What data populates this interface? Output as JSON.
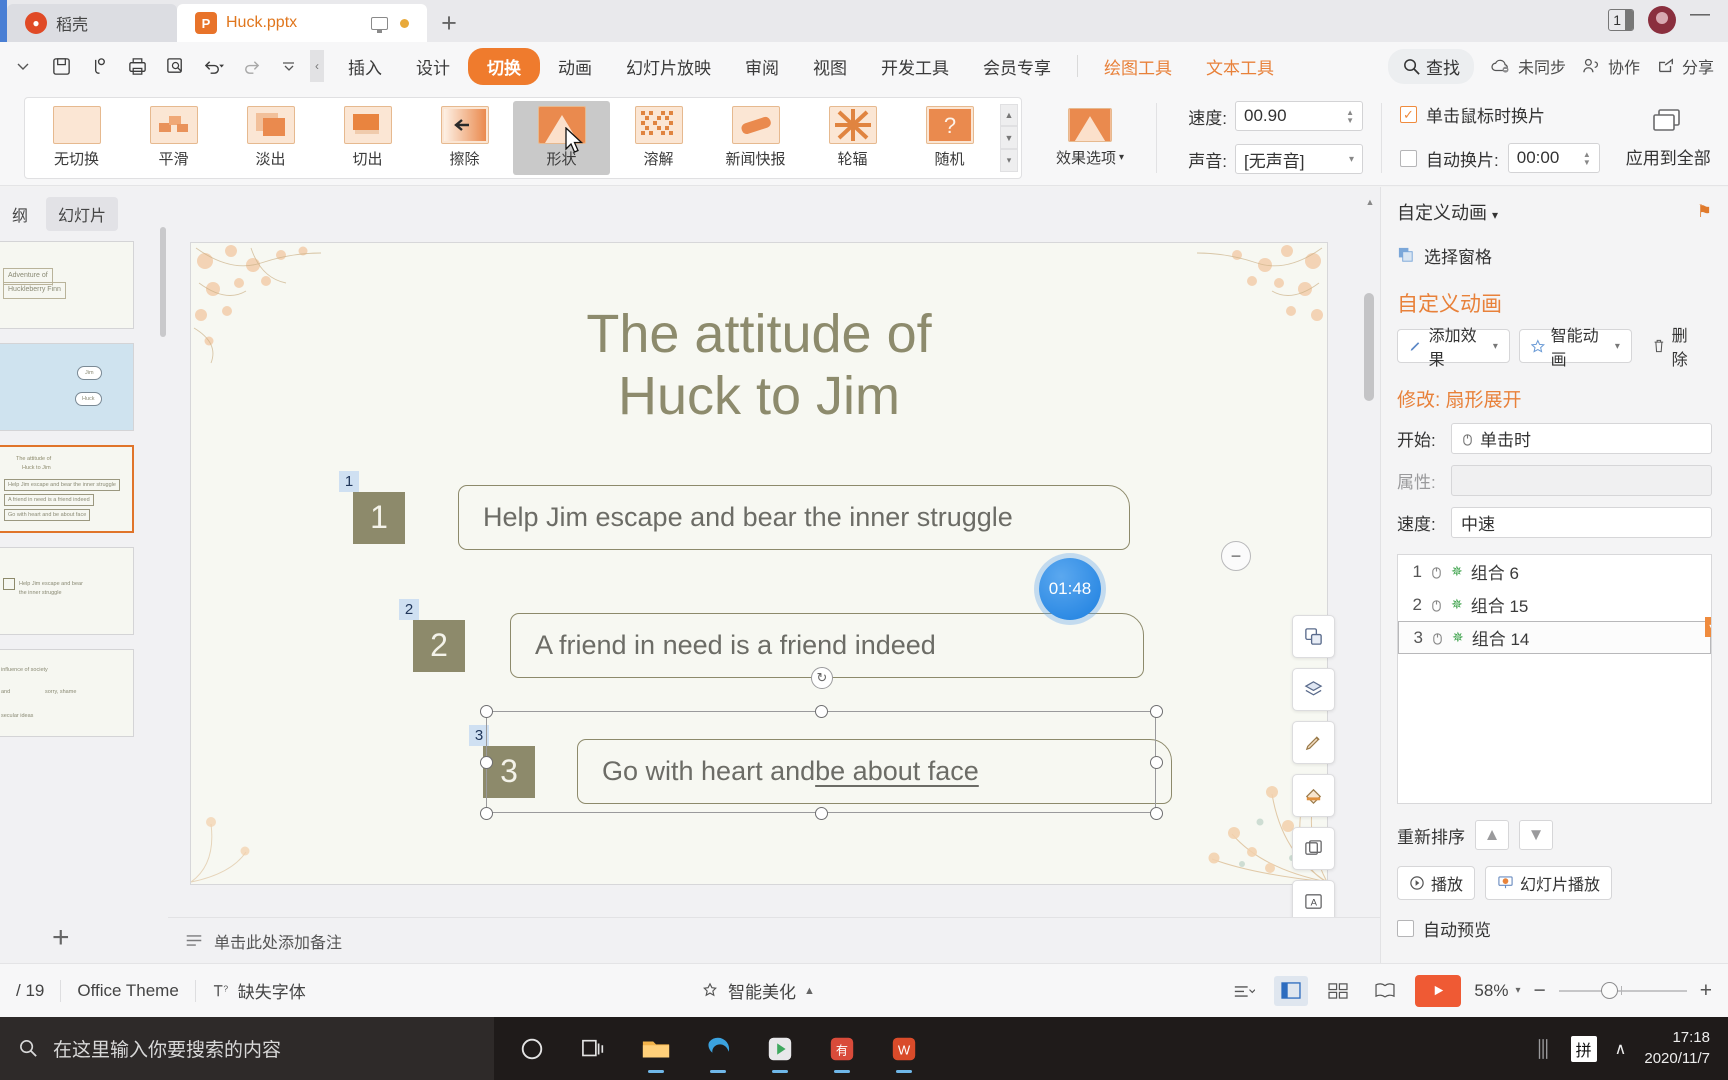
{
  "window": {
    "cloud_tab": "稻壳",
    "doc_tab": "Huck.pptx",
    "new_tab": "+",
    "window_count": "1",
    "minimize": "—"
  },
  "quick_access": [
    {
      "name": "save-icon",
      "glyph": "💾"
    },
    {
      "name": "cloud-sync-icon",
      "glyph": "↻"
    },
    {
      "name": "print-icon",
      "glyph": "⎙"
    },
    {
      "name": "print-preview-icon",
      "glyph": "⌕"
    },
    {
      "name": "undo-icon",
      "glyph": "↶"
    },
    {
      "name": "redo-icon",
      "glyph": "↷"
    },
    {
      "name": "customize-qat-icon",
      "glyph": "⌄"
    }
  ],
  "menu": {
    "collapse": "‹",
    "tabs": [
      {
        "label": "插入",
        "active": false,
        "ctx": false
      },
      {
        "label": "设计",
        "active": false,
        "ctx": false
      },
      {
        "label": "切换",
        "active": true,
        "ctx": false
      },
      {
        "label": "动画",
        "active": false,
        "ctx": false
      },
      {
        "label": "幻灯片放映",
        "active": false,
        "ctx": false
      },
      {
        "label": "审阅",
        "active": false,
        "ctx": false
      },
      {
        "label": "视图",
        "active": false,
        "ctx": false
      },
      {
        "label": "开发工具",
        "active": false,
        "ctx": false
      },
      {
        "label": "会员专享",
        "active": false,
        "ctx": false
      },
      {
        "label": "绘图工具",
        "active": false,
        "ctx": true
      },
      {
        "label": "文本工具",
        "active": false,
        "ctx": true
      }
    ],
    "find": "查找",
    "sync_status": "未同步",
    "collaborate": "协作",
    "share": "分享"
  },
  "ribbon": {
    "transitions": [
      {
        "label": "无切换",
        "thumb": "none"
      },
      {
        "label": "平滑",
        "thumb": "morph"
      },
      {
        "label": "淡出",
        "thumb": "fade"
      },
      {
        "label": "切出",
        "thumb": "cut"
      },
      {
        "label": "擦除",
        "thumb": "wipe"
      },
      {
        "label": "形状",
        "thumb": "shape",
        "hover": true
      },
      {
        "label": "溶解",
        "thumb": "dissolve"
      },
      {
        "label": "新闻快报",
        "thumb": "newsflash"
      },
      {
        "label": "轮辐",
        "thumb": "wheel"
      },
      {
        "label": "随机",
        "thumb": "random"
      }
    ],
    "effect_options": "效果选项",
    "speed_label": "速度:",
    "speed_value": "00.90",
    "sound_label": "声音:",
    "sound_value": "[无声音]",
    "on_click_label": "单击鼠标时换片",
    "on_click_checked": true,
    "auto_label": "自动换片:",
    "auto_checked": false,
    "auto_value": "00:00",
    "apply_all": "应用到全部"
  },
  "left_panel": {
    "tab_outline": "纲",
    "tab_slides": "幻灯片",
    "add_slide": "+",
    "thumbnails": [
      {
        "lines": [
          "Adventure of",
          "Huckleberry Finn"
        ],
        "selected": false
      },
      {
        "lines": [
          "Jim",
          "Huck"
        ],
        "selected": false
      },
      {
        "lines": [
          "The attitude of",
          "Huck to Jim",
          "Help Jim escape and bear the inner struggle",
          "A friend in need is a friend indeed",
          "Go with heart and be about face"
        ],
        "selected": true
      },
      {
        "lines": [
          "Help Jim  escape and bear",
          "the inner struggle"
        ],
        "selected": false
      },
      {
        "lines": [
          "influence of society",
          "and",
          "sorry, shame",
          "secular ideas"
        ],
        "selected": false
      }
    ]
  },
  "slide": {
    "title_line1": "The attitude of",
    "title_line2": "Huck to Jim",
    "rows": [
      {
        "tag": "1",
        "number": "1",
        "text": "Help Jim escape and bear the inner struggle",
        "underline": ""
      },
      {
        "tag": "2",
        "number": "2",
        "text": "A friend in need is a friend indeed",
        "underline": ""
      },
      {
        "tag": "3",
        "number": "3",
        "text": "Go with heart and ",
        "underline": "be about face"
      }
    ],
    "timer": "01:48",
    "minus": "−",
    "rotate_handle": "↻",
    "side_tools": [
      {
        "name": "layout-icon",
        "glyph": "⧉"
      },
      {
        "name": "layers-icon",
        "glyph": "☷"
      },
      {
        "name": "brush-icon",
        "glyph": "✐"
      },
      {
        "name": "fill-icon",
        "glyph": "◣"
      },
      {
        "name": "duplicate-icon",
        "glyph": "❐"
      },
      {
        "name": "textbox-icon",
        "glyph": "Ⓐ"
      }
    ]
  },
  "notes": {
    "placeholder": "单击此处添加备注"
  },
  "right_pane": {
    "header": "自定义动画",
    "header_caret": "▾",
    "pin": "⚑",
    "select_pane": "选择窗格",
    "section_title": "自定义动画",
    "add_effect": "添加效果",
    "smart_anim": "智能动画",
    "delete": "删除",
    "modify": "修改: 扇形展开",
    "start_label": "开始:",
    "start_value": "单击时",
    "property_label": "属性:",
    "property_value": "",
    "speed_label": "速度:",
    "speed_value": "中速",
    "list": [
      {
        "index": "1",
        "name": "组合 6",
        "selected": false
      },
      {
        "index": "2",
        "name": "组合 15",
        "selected": false
      },
      {
        "index": "3",
        "name": "组合 14",
        "selected": true
      }
    ],
    "reorder": "重新排序",
    "move_up": "▲",
    "move_down": "▼",
    "play": "播放",
    "slideshow": "幻灯片播放",
    "autopreview": "自动预览",
    "autopreview_checked": false
  },
  "status_bar": {
    "slide_count": "/ 19",
    "theme": "Office Theme",
    "missing_font": "缺失字体",
    "beautify": "智能美化",
    "beautify_caret": "▲",
    "zoom": "58%",
    "zoom_out": "−",
    "zoom_in": "+",
    "view_caret": "▾"
  },
  "taskbar": {
    "search_placeholder": "在这里输入你要搜索的内容",
    "ime": "拼",
    "tray_caret": "∧",
    "time": "17:18",
    "date": "2020/11/7"
  },
  "colors": {
    "accent_orange": "#ef7b2d",
    "olive": "#8d8a6b",
    "title_olive": "#8d8b6d",
    "anim_tag_blue": "#cfe0f2",
    "timer_blue": "#1c7fe0",
    "taskbar_dark": "#1f1b1a"
  }
}
